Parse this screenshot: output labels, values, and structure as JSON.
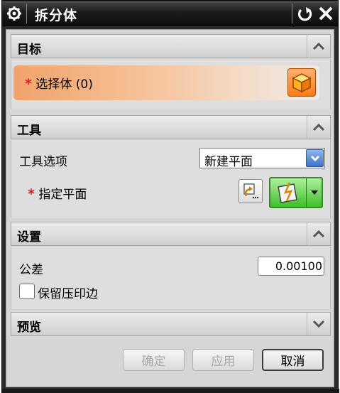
{
  "window": {
    "title": "拆分体",
    "icons": {
      "app": "gear-icon",
      "reset": "reset-icon",
      "close": "close-icon"
    }
  },
  "groups": {
    "target": {
      "title": "目标",
      "caret": "chevron-up-icon",
      "select_body": {
        "required_mark": "*",
        "label": "选择体 (0)",
        "icon": "cube-icon"
      }
    },
    "tool": {
      "title": "工具",
      "caret": "chevron-up-icon",
      "tool_option_label": "工具选项",
      "tool_option_value": "新建平面",
      "plane_required_mark": "*",
      "plane_label": "指定平面",
      "plane_icons": [
        "reverse-direction-icon",
        "plane-dialog-icon",
        "plane-dropdown-icon"
      ]
    },
    "settings": {
      "title": "设置",
      "caret": "chevron-up-icon",
      "tolerance_label": "公差",
      "tolerance_value": "0.00100",
      "keep_imprint_label": "保留压印边",
      "keep_imprint_checked": false
    },
    "preview": {
      "title": "预览",
      "caret": "chevron-down-icon"
    }
  },
  "footer": {
    "ok_label": "确定",
    "apply_label": "应用",
    "cancel_label": "取消"
  },
  "colors": {
    "accent_orange": "#f0a36a",
    "plane_button_green": "#3fbf2a",
    "dropdown_blue": "#3f72c8",
    "required_red": "#e02020"
  }
}
